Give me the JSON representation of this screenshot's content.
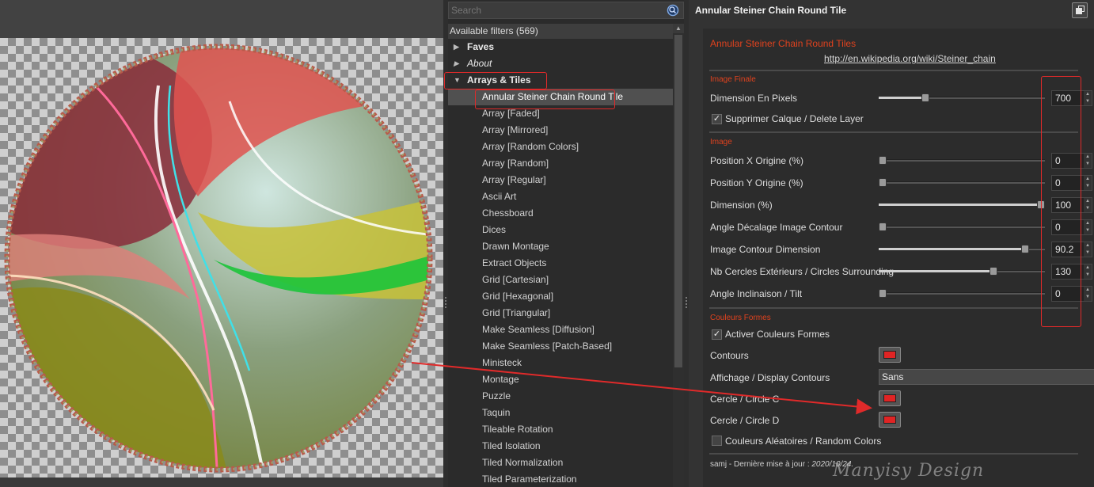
{
  "search": {
    "placeholder": "Search"
  },
  "filters": {
    "header": "Available filters (569)",
    "categories": [
      {
        "label": "Faves",
        "italic": false
      },
      {
        "label": "About",
        "italic": true
      },
      {
        "label": "Arrays & Tiles",
        "italic": false
      }
    ],
    "items": [
      "Annular Steiner Chain Round Tile",
      "Array [Faded]",
      "Array [Mirrored]",
      "Array [Random Colors]",
      "Array [Random]",
      "Array [Regular]",
      "Ascii Art",
      "Chessboard",
      "Dices",
      "Drawn Montage",
      "Extract Objects",
      "Grid [Cartesian]",
      "Grid [Hexagonal]",
      "Grid [Triangular]",
      "Make Seamless [Diffusion]",
      "Make Seamless [Patch-Based]",
      "Ministeck",
      "Montage",
      "Puzzle",
      "Taquin",
      "Tileable Rotation",
      "Tiled Isolation",
      "Tiled Normalization",
      "Tiled Parameterization"
    ],
    "selected_index": 0
  },
  "params": {
    "title": "Annular Steiner Chain Round Tile",
    "filter_name": "Annular Steiner Chain Round Tiles",
    "link": "http://en.wikipedia.org/wiki/Steiner_chain",
    "section_image_finale": "Image Finale",
    "dimension_pixels": {
      "label": "Dimension En Pixels",
      "value": "700",
      "fraction": 0.27
    },
    "delete_layer": {
      "label": "Supprimer Calque / Delete Layer",
      "checked": true,
      "mark": "✓"
    },
    "section_image": "Image",
    "sliders": [
      {
        "label": "Position X Origine (%)",
        "value": "0",
        "fraction": 0.0
      },
      {
        "label": "Position Y Origine (%)",
        "value": "0",
        "fraction": 0.0
      },
      {
        "label": "Dimension (%)",
        "value": "100",
        "fraction": 1.0
      },
      {
        "label": "Angle Décalage Image Contour",
        "value": "0",
        "fraction": 0.0
      },
      {
        "label": "Image Contour Dimension",
        "value": "90.2",
        "fraction": 0.902
      },
      {
        "label": "Nb Cercles Extérieurs / Circles Surrounding",
        "value": "130",
        "fraction": 0.7
      },
      {
        "label": "Angle Inclinaison / Tilt",
        "value": "0",
        "fraction": 0.0
      }
    ],
    "section_couleurs": "Couleurs Formes",
    "activer_couleurs": {
      "label": "Activer Couleurs Formes",
      "checked": true,
      "mark": "✓"
    },
    "contours": {
      "label": "Contours",
      "color": "#e02424"
    },
    "affichage": {
      "label": "Affichage / Display Contours",
      "value": "Sans"
    },
    "cercle_c": {
      "label": "Cercle / Circle C",
      "color": "#e02424"
    },
    "cercle_d": {
      "label": "Cercle / Circle D",
      "color": "#e02424"
    },
    "random_colors": {
      "label": "Couleurs Aléatoires / Random Colors",
      "checked": false,
      "mark": ""
    },
    "footer_prefix": "samj - Dernière mise à jour : ",
    "footer_date": "2020/10/24."
  },
  "watermark": "Manyisy Design",
  "colors": {
    "annotation_red": "#e02a2a",
    "accent_orange": "#e0421e"
  }
}
